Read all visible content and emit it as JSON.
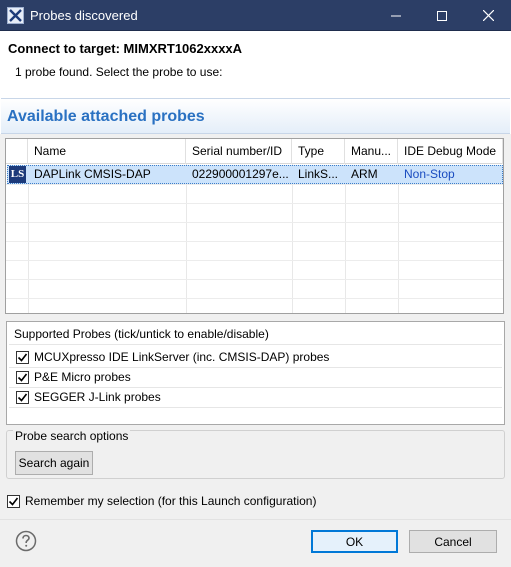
{
  "window": {
    "title": "Probes discovered",
    "close_label": "✕",
    "minimize_label": "—",
    "maximize_label": "☐"
  },
  "header": {
    "connect_title": "Connect to target: MIMXRT1062xxxxA",
    "message": "1 probe found. Select the probe to use:"
  },
  "section_title": "Available attached probes",
  "table": {
    "columns": [
      "",
      "Name",
      "Serial number/ID",
      "Type",
      "Manu...",
      "IDE Debug Mode"
    ],
    "rows": [
      {
        "icon_text": "LS",
        "name": "DAPLink CMSIS-DAP",
        "serial": "022900001297e...",
        "type": "LinkS...",
        "manufacturer": "ARM",
        "mode": "Non-Stop"
      }
    ]
  },
  "supported": {
    "title": "Supported Probes (tick/untick to enable/disable)",
    "items": [
      {
        "label": "MCUXpresso IDE LinkServer (inc. CMSIS-DAP) probes",
        "checked": true
      },
      {
        "label": "P&E Micro probes",
        "checked": true
      },
      {
        "label": "SEGGER J-Link probes",
        "checked": true
      }
    ]
  },
  "search": {
    "legend": "Probe search options",
    "button_label": "Search again"
  },
  "remember": {
    "label": "Remember my selection (for this Launch configuration)",
    "checked": true
  },
  "footer": {
    "ok_label": "OK",
    "cancel_label": "Cancel"
  },
  "colors": {
    "titlebar": "#2c3e66",
    "accent": "#2a71c2",
    "selection": "#cce3fb",
    "mode_text": "#1a4cc0"
  }
}
